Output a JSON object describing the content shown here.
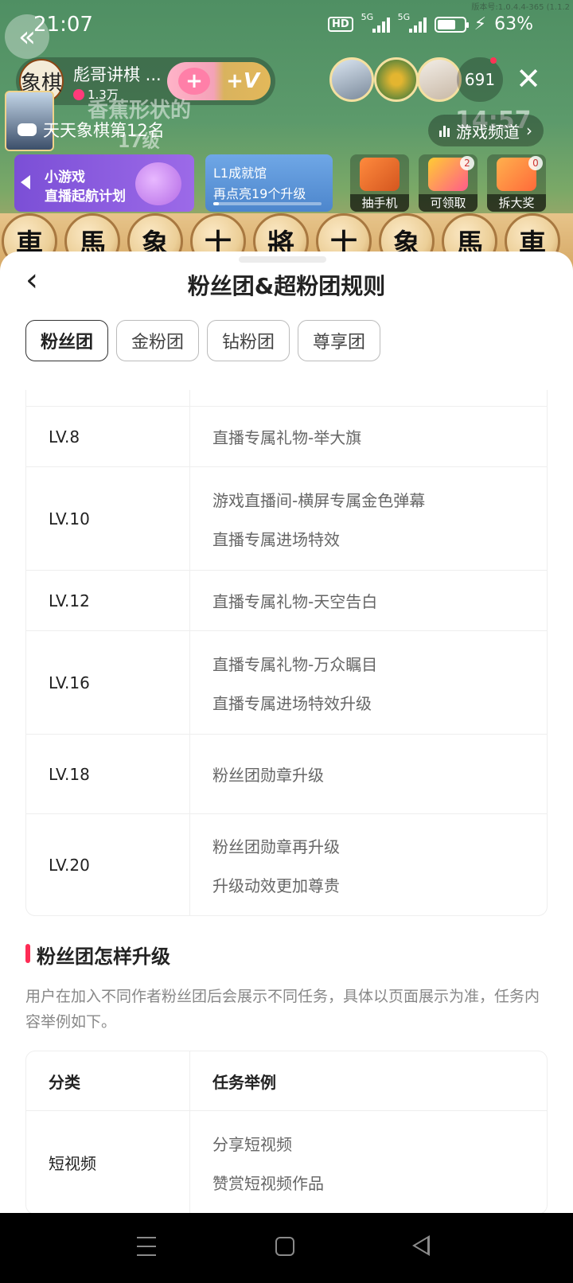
{
  "status_bar": {
    "time": "21:07",
    "network_badge": "HD",
    "signal_1": "5G",
    "signal_2": "5G",
    "battery": "63%",
    "version_watermark": "版本号:1.0.4.4-365 (1.1.2"
  },
  "live": {
    "host_name": "彪哥讲棋 ...",
    "host_avatar_text": "象棋",
    "host_fans": "1.3万",
    "join_plus": "+",
    "join_v": "+V",
    "viewer_count": "691",
    "game_label": "天天象棋第12名",
    "banner_line1": "香蕉形状的",
    "banner_line2": "17级",
    "timer_text": "14:57",
    "channel_label": "游戏频道",
    "promo_title": "小游戏",
    "promo_subtitle": "直播起航计划",
    "achievement_title": "L1成就馆",
    "achievement_subtitle": "再点亮19个升级",
    "achievement_progress": 0.05,
    "activities": [
      {
        "label": "抽手机",
        "badge": ""
      },
      {
        "label": "可领取",
        "badge": "2"
      },
      {
        "label": "拆大奖",
        "badge": "0"
      }
    ],
    "board_pieces": [
      "車",
      "馬",
      "象",
      "士",
      "將",
      "士",
      "象",
      "馬",
      "車"
    ]
  },
  "sheet": {
    "title": "粉丝团&超粉团规则",
    "tabs": [
      "粉丝团",
      "金粉团",
      "钻粉团",
      "尊享团"
    ],
    "active_tab": 0,
    "level_rows": [
      {
        "level": "LV.8",
        "rewards": [
          "直播专属礼物-举大旗"
        ]
      },
      {
        "level": "LV.10",
        "rewards": [
          "游戏直播间-横屏专属金色弹幕",
          "直播专属进场特效"
        ]
      },
      {
        "level": "LV.12",
        "rewards": [
          "直播专属礼物-天空告白"
        ]
      },
      {
        "level": "LV.16",
        "rewards": [
          "直播专属礼物-万众瞩目",
          "直播专属进场特效升级"
        ]
      },
      {
        "level": "LV.18",
        "rewards": [
          "粉丝团勋章升级"
        ]
      },
      {
        "level": "LV.20",
        "rewards": [
          "粉丝团勋章再升级",
          "升级动效更加尊贵"
        ]
      }
    ],
    "section_title": "粉丝团怎样升级",
    "section_desc": "用户在加入不同作者粉丝团后会展示不同任务，具体以页面展示为准，任务内容举例如下。",
    "task_table": {
      "header": {
        "category": "分类",
        "example": "任务举例"
      },
      "rows": [
        {
          "category": "短视频",
          "examples": [
            "分享短视频",
            "赞赏短视频作品"
          ]
        }
      ]
    }
  }
}
